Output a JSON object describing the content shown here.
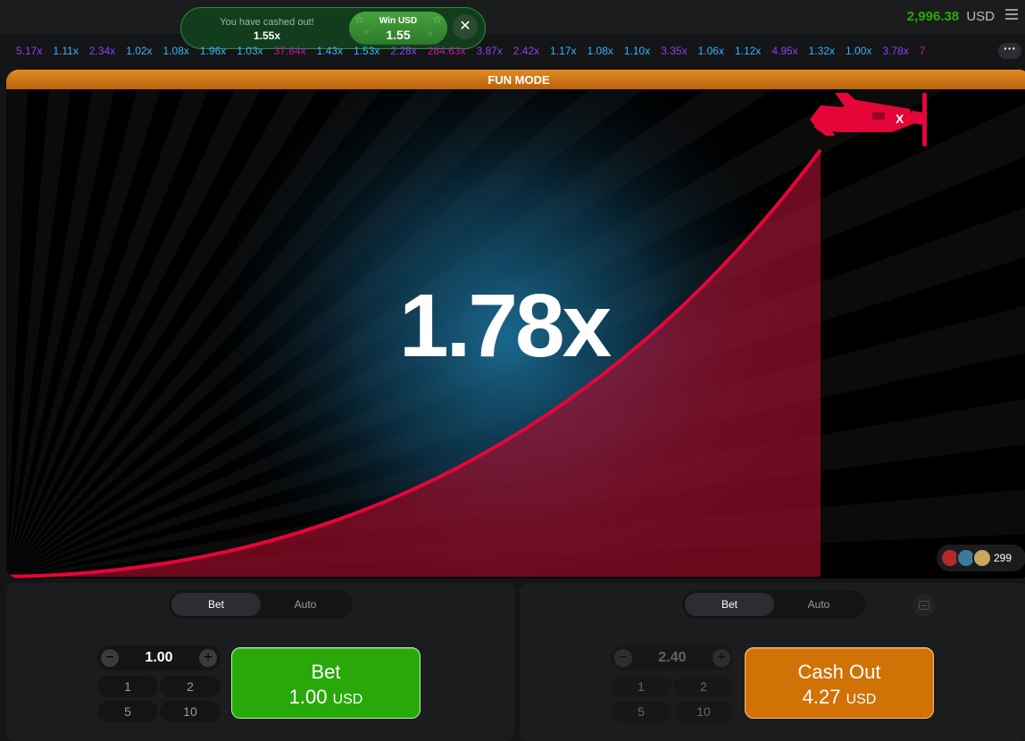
{
  "header": {
    "balance_amount": "2,996.38",
    "balance_currency": "USD",
    "menu_icon": "hamburger-icon"
  },
  "toast": {
    "message": "You have cashed out!",
    "multiplier": "1.55x",
    "win_label": "Win USD",
    "win_amount": "1.55",
    "close_icon": "close-icon",
    "close_glyph": "✕"
  },
  "history": {
    "items": [
      {
        "text": "5.17x",
        "color": "#913ef8"
      },
      {
        "text": "1.11x",
        "color": "#34b4ff"
      },
      {
        "text": "2.34x",
        "color": "#913ef8"
      },
      {
        "text": "1.02x",
        "color": "#34b4ff"
      },
      {
        "text": "1.08x",
        "color": "#34b4ff"
      },
      {
        "text": "1.96x",
        "color": "#34b4ff"
      },
      {
        "text": "1.03x",
        "color": "#34b4ff"
      },
      {
        "text": "37.84x",
        "color": "#c017b4"
      },
      {
        "text": "1.43x",
        "color": "#34b4ff"
      },
      {
        "text": "1.53x",
        "color": "#34b4ff"
      },
      {
        "text": "2.28x",
        "color": "#913ef8"
      },
      {
        "text": "284.63x",
        "color": "#c017b4"
      },
      {
        "text": "3.87x",
        "color": "#913ef8"
      },
      {
        "text": "2.42x",
        "color": "#913ef8"
      },
      {
        "text": "1.17x",
        "color": "#34b4ff"
      },
      {
        "text": "1.08x",
        "color": "#34b4ff"
      },
      {
        "text": "1.10x",
        "color": "#34b4ff"
      },
      {
        "text": "3.35x",
        "color": "#913ef8"
      },
      {
        "text": "1.06x",
        "color": "#34b4ff"
      },
      {
        "text": "1.12x",
        "color": "#34b4ff"
      },
      {
        "text": "4.95x",
        "color": "#913ef8"
      },
      {
        "text": "1.32x",
        "color": "#34b4ff"
      },
      {
        "text": "1.00x",
        "color": "#34b4ff"
      },
      {
        "text": "3.78x",
        "color": "#913ef8"
      },
      {
        "text": "7",
        "color": "#c017b4"
      }
    ],
    "more_icon": "more-icon",
    "more_glyph": "···"
  },
  "game": {
    "mode_label": "FUN MODE",
    "multiplier": "1.78x",
    "players_count": "299",
    "plane_icon": "airplane-icon",
    "curve_color": "#e50539"
  },
  "panel_left": {
    "tab_bet": "Bet",
    "tab_auto": "Auto",
    "stepper_value": "1.00",
    "minus_glyph": "−",
    "plus_glyph": "+",
    "quick_amounts": [
      "1",
      "2",
      "5",
      "10"
    ],
    "button_title": "Bet",
    "button_amount": "1.00",
    "button_unit": "USD"
  },
  "panel_right": {
    "tab_bet": "Bet",
    "tab_auto": "Auto",
    "stepper_value": "2.40",
    "minus_glyph": "−",
    "plus_glyph": "+",
    "quick_amounts": [
      "1",
      "2",
      "5",
      "10"
    ],
    "button_title": "Cash Out",
    "button_amount": "4.27",
    "button_unit": "USD",
    "collapse_icon": "collapse-icon"
  }
}
